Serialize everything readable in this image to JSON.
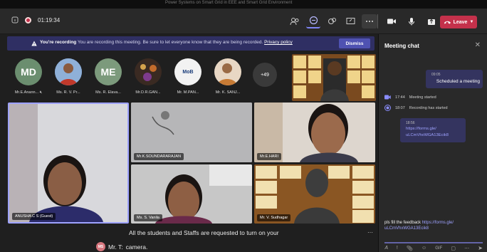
{
  "window": {
    "caption": "Power Systems on Smart Grid in EEE and Smart Grid Environment"
  },
  "toolbar": {
    "timer": "01:19:34",
    "leave_label": "Leave"
  },
  "recording_banner": {
    "bold": "You're recording",
    "text": "You are recording this meeting. Be sure to let everyone know that they are being recorded.",
    "link": "Privacy policy",
    "dismiss_label": "Dismiss"
  },
  "participants": [
    {
      "initials": "MD",
      "label": "Mr.E.Anann...",
      "color": "#6b8e6f"
    },
    {
      "initials": "",
      "label": "Ms. R. V. Pr...",
      "color": "#5a7fbf"
    },
    {
      "initials": "ME",
      "label": "Ms. R. Elava...",
      "color": "#7c9a7c"
    },
    {
      "initials": "",
      "label": "Mr.D.R.GAN...",
      "color": "#4e3a2a"
    },
    {
      "initials": "MoB",
      "label": "Mr. M.PAN...",
      "color": "#f2f2f2"
    },
    {
      "initials": "",
      "label": "Mr. K. SANJ...",
      "color": "#c77b35"
    }
  ],
  "more_participants": "+49",
  "tiles": {
    "t1": "ANUSHA C S (Guest)",
    "t2": "Mr.K.SOUNDARARAJAN",
    "t3": "Mr.E.HARI",
    "t4": "Ms. S. Vanila",
    "t5": "Mr. V. Sudhagar"
  },
  "captions": {
    "line1": "All the students and Staffs are requested to turn on your",
    "speaker_initials": "MS",
    "speaker": "Mr. T:",
    "line2": "camera."
  },
  "chat": {
    "title": "Meeting chat",
    "msg1_time": "09:05",
    "msg1_text": "Scheduled a meeting",
    "ev1_time": "17:44",
    "ev1_text": "Meeting started",
    "ev2_time": "18:07",
    "ev2_text": "Recording has started",
    "msg2_time": "18:56",
    "msg2_link1": "https://forms.gle/",
    "msg2_link2": "uLCmVhxWGA13Ecik8",
    "input_text": "pls fill the feedback",
    "input_link1": "https://forms.gle/",
    "input_link2": "uLCmVhxWGA13Ecik8"
  },
  "colors": {
    "accent": "#6264a7",
    "leave": "#c4314b",
    "banner": "#2f2f63"
  }
}
